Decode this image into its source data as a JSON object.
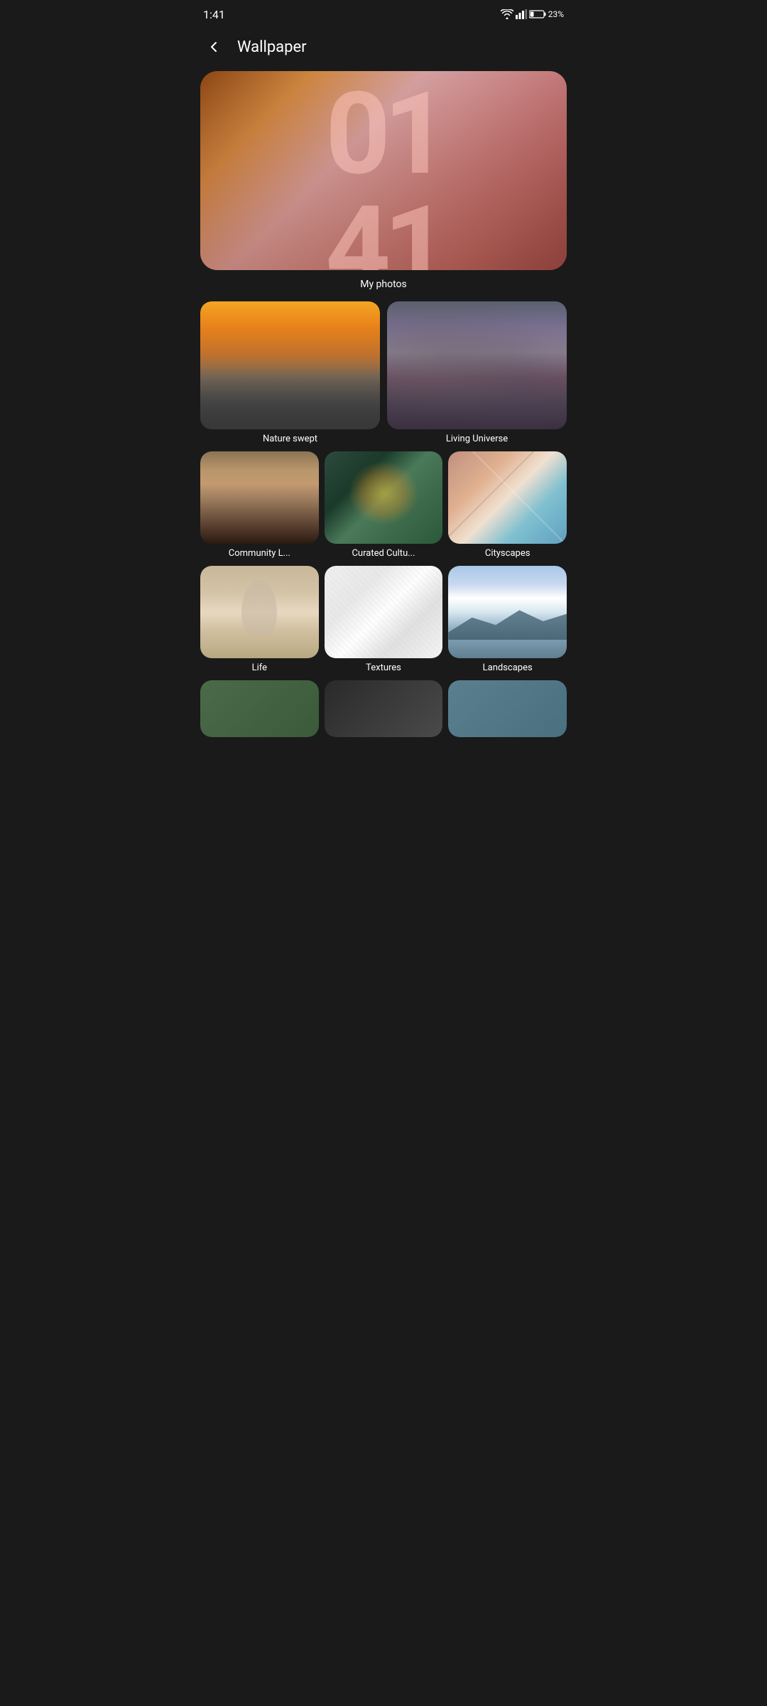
{
  "statusBar": {
    "time": "1:41",
    "battery": "23%",
    "batteryIcon": "battery-icon",
    "wifiIcon": "wifi-icon",
    "signalIcon": "signal-icon"
  },
  "header": {
    "title": "Wallpaper",
    "backLabel": "back"
  },
  "categories": {
    "myPhotos": {
      "label": "My photos",
      "overlayText": "01\n41"
    },
    "large": [
      {
        "id": "nature-swept",
        "label": "Nature swept"
      },
      {
        "id": "living-universe",
        "label": "Living Universe"
      }
    ],
    "medium": [
      {
        "id": "community",
        "label": "Community L..."
      },
      {
        "id": "curated",
        "label": "Curated Cultu..."
      },
      {
        "id": "cityscapes",
        "label": "Cityscapes"
      },
      {
        "id": "life",
        "label": "Life"
      },
      {
        "id": "textures",
        "label": "Textures"
      },
      {
        "id": "landscapes",
        "label": "Landscapes"
      }
    ],
    "partial": [
      {
        "id": "partial-1",
        "label": ""
      },
      {
        "id": "partial-2",
        "label": ""
      },
      {
        "id": "partial-3",
        "label": ""
      }
    ]
  }
}
